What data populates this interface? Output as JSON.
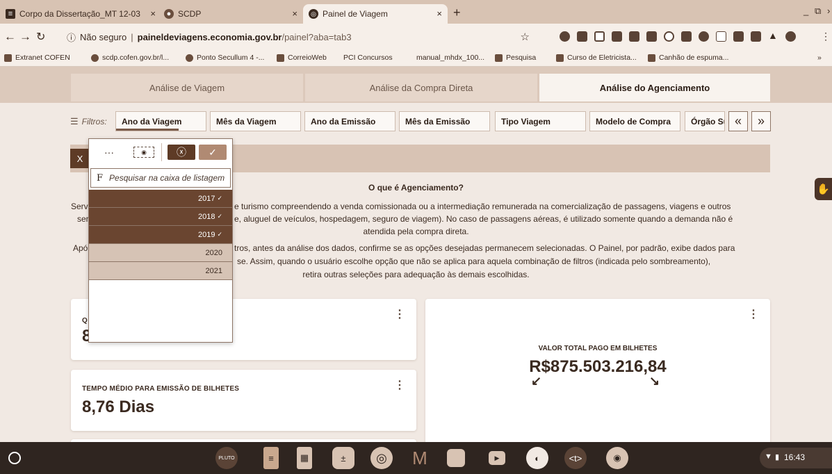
{
  "browser": {
    "tabs": [
      {
        "label": "Corpo da Dissertação_MT 12-03",
        "icon": "docs-icon"
      },
      {
        "label": "SCDP",
        "icon": "scdp-icon"
      },
      {
        "label": "Painel de Viagem",
        "icon": "globe-icon"
      }
    ],
    "address": {
      "security": "Não seguro",
      "host": "paineldeviagens.economia.gov.br",
      "path": "/painel?aba=tab3"
    },
    "bookmarks": [
      "Extranet COFEN",
      "scdp.cofen.gov.br/l...",
      "Ponto Secullum 4 -...",
      "CorreioWeb",
      "PCI Concursos",
      "manual_mhdx_100...",
      "Pesquisa",
      "Curso de Eletricista...",
      "Canhão de espuma..."
    ]
  },
  "page": {
    "tabs": [
      "Análise de Viagem",
      "Análise da Compra Direta",
      "Análise do Agenciamento"
    ],
    "active_tab": "Análise do Agenciamento",
    "filter_label": "Filtros:",
    "filters": [
      "Ano da Viagem",
      "Mês da Viagem",
      "Ano da Emissão",
      "Mês da Emissão",
      "Tipo Viagem",
      "Modelo de Compra",
      "Órgão Su"
    ],
    "selection_clear": "X",
    "info": {
      "title": "O que é Agenciamento?",
      "line1_a": "Serv",
      "line1_b": "e turismo compreendendo a venda comissionada ou a intermediação remunerada na comercialização de passagens, viagens e outros",
      "line2_a": "ser",
      "line2_b": "e, aluguel de veículos, hospedagem, seguro de viagem). No caso de passagens aéreas, é utilizado somente quando a demanda não é",
      "line3": "atendida pela compra direta.",
      "line4_a": "Apó",
      "line4_b": "tros, antes da análise dos dados, confirme se as opções desejadas permanecem selecionadas. O Painel, por padrão, exibe dados para",
      "line5": "se. Assim, quando o usuário escolhe opção que não se aplica para aquela combinação de filtros (indicada pelo sombreamento),",
      "line6": "retira outras seleções para adequação às demais escolhidas."
    },
    "cards": {
      "card1_label": "Q",
      "card1_value": "8",
      "card2_label": "TEMPO MÉDIO PARA EMISSÃO DE BILHETES",
      "card2_value": "8,76 Dias",
      "card3_label": "VALOR TOTAL PAGO EM BILHETES",
      "card3_value": "R$875.503.216,84",
      "menu_glyph": "⋮"
    },
    "dropdown": {
      "search_placeholder": "Pesquisar na caixa de listagem",
      "search_glyph": "F",
      "items": [
        {
          "label": "2017",
          "state": "selected"
        },
        {
          "label": "2018",
          "state": "selected"
        },
        {
          "label": "2019",
          "state": "selected"
        },
        {
          "label": "2020",
          "state": "alternative"
        },
        {
          "label": "2021",
          "state": "alternative"
        }
      ],
      "check": "✓"
    }
  },
  "shelf": {
    "apps": [
      "pluto-app",
      "docs-app",
      "sheets-app",
      "calculator-app",
      "chrome-app",
      "gmail-app",
      "files-app",
      "play-app",
      "chrome-remote-app",
      "text-app",
      "hangouts-app"
    ],
    "pluto_label": "PLUTO",
    "text_label": "<t>",
    "clock": "16:43"
  },
  "colors": {
    "accent_dark": "#6a4530",
    "accent_light": "#d6c3b5",
    "background": "#f1e9e3"
  }
}
